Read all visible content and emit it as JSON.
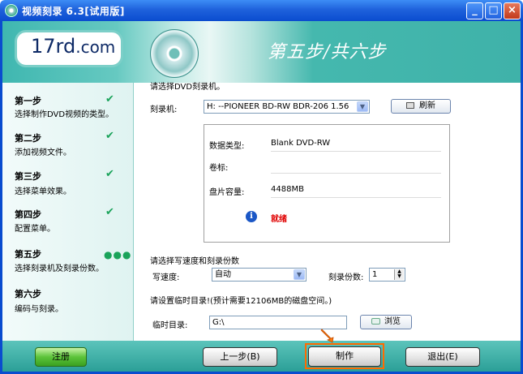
{
  "window": {
    "title": "视频刻录 6.3[试用版]",
    "minimize": "_",
    "maximize": "□",
    "close": "×"
  },
  "header": {
    "logo": "17rd",
    "logo_suffix": ".com",
    "step_heading": "第五步/共六步"
  },
  "sidebar": {
    "steps": [
      {
        "title": "第一步",
        "desc": "选择制作DVD视频的类型。",
        "status": "✔"
      },
      {
        "title": "第二步",
        "desc": "添加视频文件。",
        "status": "✔"
      },
      {
        "title": "第三步",
        "desc": "选择菜单效果。",
        "status": "✔"
      },
      {
        "title": "第四步",
        "desc": "配置菜单。",
        "status": "✔"
      },
      {
        "title": "第五步",
        "desc": "选择刻录机及刻录份数。",
        "status": "●●●"
      },
      {
        "title": "第六步",
        "desc": "编码与刻录。",
        "status": ""
      }
    ]
  },
  "main": {
    "choose_burner": "请选择DVD刻录机。",
    "burner_label": "刻录机:",
    "burner_value": "H:  --PIONEER BD-RW   BDR-206  1.56",
    "refresh": "刷新",
    "info": {
      "data_type_label": "数据类型:",
      "data_type_value": "Blank DVD-RW",
      "volume_label": "卷标:",
      "volume_value": "",
      "capacity_label": "盘片容量:",
      "capacity_value": "4488MB",
      "status": "就绪",
      "info_icon": "i"
    },
    "speed_section": "请选择写速度和刻录份数",
    "speed_label": "写速度:",
    "speed_value": "自动",
    "copies_label": "刻录份数:",
    "copies_value": "1",
    "temp_note": "请设置临时目录!(预计需要12106MB的磁盘空间。)",
    "temp_label": "临时目录:",
    "temp_value": "G:\\",
    "browse": "浏览"
  },
  "footer": {
    "register": "注册",
    "prev": "上一步(B)",
    "make": "制作",
    "exit": "退出(E)"
  },
  "colors": {
    "titlebar": "#1f62dc",
    "header": "#45b8ae",
    "ready": "#e00000",
    "check": "#1aa35a",
    "highlight": "#ff6a00"
  }
}
